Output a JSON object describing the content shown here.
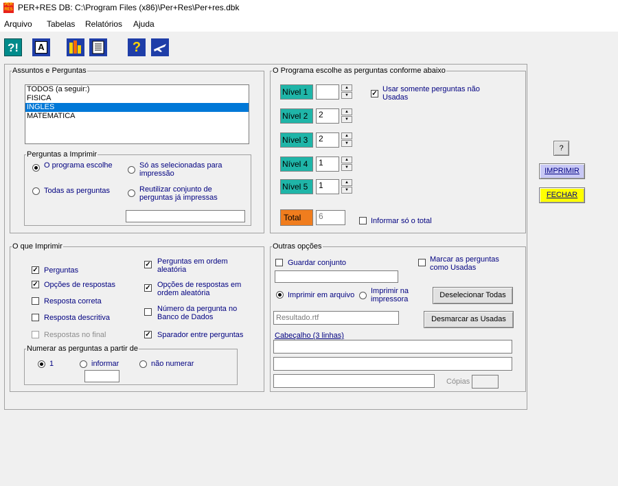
{
  "window": {
    "title": "PER+RES   DB: C:\\Program Files (x86)\\Per+Res\\Per+res.dbk",
    "app_icon_text": "PER RES"
  },
  "menu": [
    {
      "label": "Arquivo"
    },
    {
      "label": "Tabelas"
    },
    {
      "label": "Relatórios"
    },
    {
      "label": "Ajuda"
    }
  ],
  "toolbar": {
    "help_context": "?!",
    "font": "A",
    "chart": "chart",
    "report": "report",
    "help": "?",
    "exit": "exit"
  },
  "assuntos": {
    "legend": "Assuntos e Perguntas",
    "items": [
      "TODOS (a seguir:)",
      "FISICA",
      "INGLES",
      "MATEMATICA"
    ],
    "selected": "INGLES"
  },
  "perguntas_imprimir": {
    "legend": "Perguntas a Imprimir",
    "opt_programa": "O programa escolhe",
    "opt_selecionadas": "Só as selecionadas para impressão",
    "opt_todas": "Todas as perguntas",
    "opt_reutilizar": "Reutilizar conjunto de perguntas já impressas",
    "selected": "opt_programa",
    "reutilizar_value": ""
  },
  "programa": {
    "legend": "O Programa escolhe as perguntas conforme abaixo",
    "niveis": [
      {
        "label": "Nível 1",
        "value": ""
      },
      {
        "label": "Nível 2",
        "value": "2"
      },
      {
        "label": "Nível 3",
        "value": "2"
      },
      {
        "label": "Nível 4",
        "value": "1"
      },
      {
        "label": "Nível 5",
        "value": "1"
      }
    ],
    "usar_somente": "Usar somente perguntas não Usadas",
    "usar_somente_checked": true,
    "total_label": "Total",
    "total_value": "6",
    "informar_total": "Informar só o total",
    "informar_total_checked": false
  },
  "side_buttons": {
    "help": "?",
    "imprimir": "IMPRIMIR",
    "fechar": "FECHAR",
    "imprimir_color": "#c8c8f5",
    "fechar_color": "#ffff00"
  },
  "o_que_imprimir": {
    "legend": "O que Imprimir",
    "left": [
      {
        "label": "Perguntas",
        "checked": true,
        "disabled": false
      },
      {
        "label": "Opções de respostas",
        "checked": true,
        "disabled": false
      },
      {
        "label": "Resposta correta",
        "checked": false,
        "disabled": false
      },
      {
        "label": "Resposta descritiva",
        "checked": false,
        "disabled": false
      },
      {
        "label": "Respostas no final",
        "checked": false,
        "disabled": true
      }
    ],
    "right": [
      {
        "label": "Perguntas em ordem aleatória",
        "checked": true
      },
      {
        "label": "Opções de respostas em ordem aleatória",
        "checked": true
      },
      {
        "label": "Número da pergunta no Banco de Dados",
        "checked": false
      },
      {
        "label": "Sparador entre perguntas",
        "checked": true
      }
    ],
    "numerar": {
      "legend": "Numerar as perguntas a partir de",
      "opt_1": "1",
      "opt_informar": "informar",
      "opt_nao": "não numerar",
      "selected": "opt_1",
      "informar_value": ""
    }
  },
  "outras": {
    "legend": "Outras opções",
    "guardar": "Guardar conjunto",
    "guardar_checked": false,
    "guardar_value": "",
    "marcar": "Marcar as perguntas como Usadas",
    "marcar_checked": false,
    "imprimir_arquivo": "Imprimir em arquivo",
    "imprimir_impressora": "Imprimir na impressora",
    "selected": "imprimir_arquivo",
    "arquivo_value": "Resultado.rtf",
    "deselecionar": "Deselecionar Todas",
    "desmarcar": "Desmarcar as Usadas",
    "cabecalho_label": "Cabeçalho (3 linhas)",
    "cabecalho": [
      "",
      "",
      ""
    ],
    "copias_label": "Cópias",
    "copias_value": ""
  }
}
